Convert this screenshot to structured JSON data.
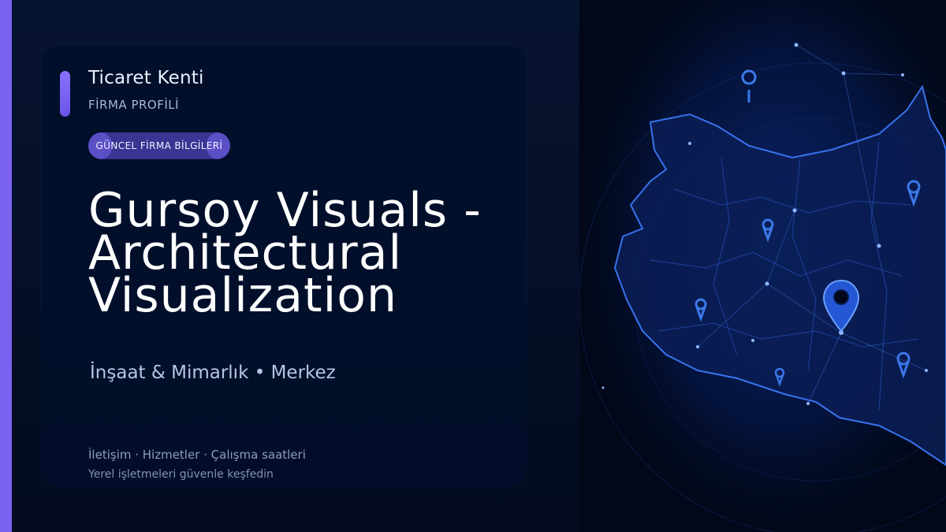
{
  "brand": {
    "name": "Ticaret Kenti",
    "subtitle": "FİRMA PROFİLİ"
  },
  "badge": {
    "label": "GÜNCEL FİRMA BİLGİLERİ"
  },
  "headline": {
    "line1": "Gursoy Visuals -",
    "line2": "Architectural",
    "line3": "Visualization"
  },
  "category": {
    "text": "İnşaat & Mimarlık • Merkez"
  },
  "footer": {
    "links": "İletişim · Hizmetler · Çalışma saatleri",
    "tagline": "Yerel işletmeleri güvenle keşfedin"
  },
  "colors": {
    "accent": "#7b63ef",
    "background": "#050c1f",
    "badge": "#3a3592",
    "map_glow": "#2f6bff"
  },
  "icons": [
    "map-pin-icon"
  ]
}
